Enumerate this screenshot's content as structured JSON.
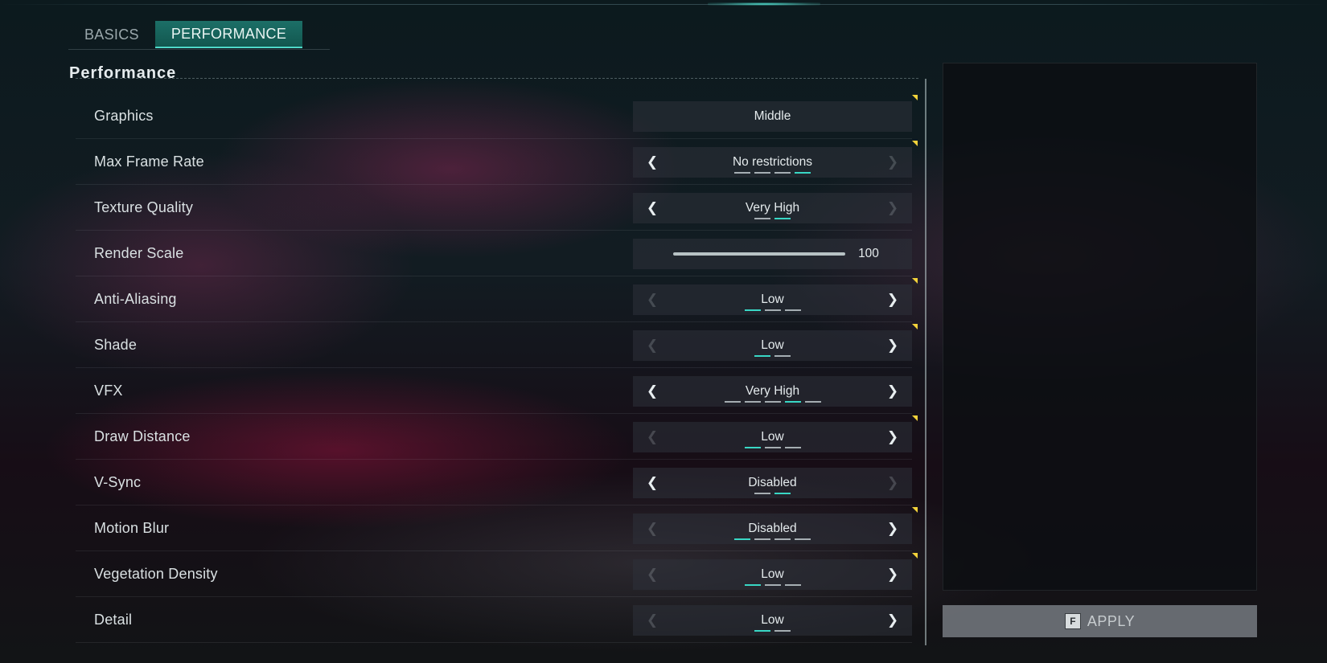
{
  "tabs": [
    {
      "label": "BASICS",
      "active": false
    },
    {
      "label": "PERFORMANCE",
      "active": true
    }
  ],
  "section_title": "Performance",
  "settings": [
    {
      "label": "Graphics",
      "value": "Middle",
      "type": "dropdown",
      "flag": true
    },
    {
      "label": "Max Frame Rate",
      "value": "No restrictions",
      "type": "selector",
      "left_enabled": true,
      "right_enabled": false,
      "options_count": 4,
      "selected_index": 3,
      "flag": true
    },
    {
      "label": "Texture Quality",
      "value": "Very High",
      "type": "selector",
      "left_enabled": true,
      "right_enabled": false,
      "options_count": 2,
      "selected_index": 1,
      "flag": false
    },
    {
      "label": "Render Scale",
      "value": "100",
      "type": "slider",
      "flag": false
    },
    {
      "label": "Anti-Aliasing",
      "value": "Low",
      "type": "selector",
      "left_enabled": false,
      "right_enabled": true,
      "options_count": 3,
      "selected_index": 0,
      "flag": true
    },
    {
      "label": "Shade",
      "value": "Low",
      "type": "selector",
      "left_enabled": false,
      "right_enabled": true,
      "options_count": 2,
      "selected_index": 0,
      "flag": true
    },
    {
      "label": "VFX",
      "value": "Very High",
      "type": "selector",
      "left_enabled": true,
      "right_enabled": true,
      "options_count": 5,
      "selected_index": 3,
      "flag": false
    },
    {
      "label": "Draw Distance",
      "value": "Low",
      "type": "selector",
      "left_enabled": false,
      "right_enabled": true,
      "options_count": 3,
      "selected_index": 0,
      "flag": true
    },
    {
      "label": "V-Sync",
      "value": "Disabled",
      "type": "selector",
      "left_enabled": true,
      "right_enabled": false,
      "options_count": 2,
      "selected_index": 1,
      "flag": false
    },
    {
      "label": "Motion Blur",
      "value": "Disabled",
      "type": "selector",
      "left_enabled": false,
      "right_enabled": true,
      "options_count": 4,
      "selected_index": 0,
      "flag": true
    },
    {
      "label": "Vegetation Density",
      "value": "Low",
      "type": "selector",
      "left_enabled": false,
      "right_enabled": true,
      "options_count": 3,
      "selected_index": 0,
      "flag": true
    },
    {
      "label": "Detail",
      "value": "Low",
      "type": "selector",
      "left_enabled": false,
      "right_enabled": true,
      "options_count": 2,
      "selected_index": 0,
      "flag": false
    }
  ],
  "icons": {
    "left": "chevron-left-icon",
    "right": "chevron-right-icon",
    "left_glyph": "❮",
    "right_glyph": "❯"
  },
  "apply": {
    "key": "F",
    "label": "APPLY"
  },
  "colors": {
    "accent": "#39d7c5",
    "tab_active": "#1c6f67",
    "flag": "#f2d23a"
  }
}
